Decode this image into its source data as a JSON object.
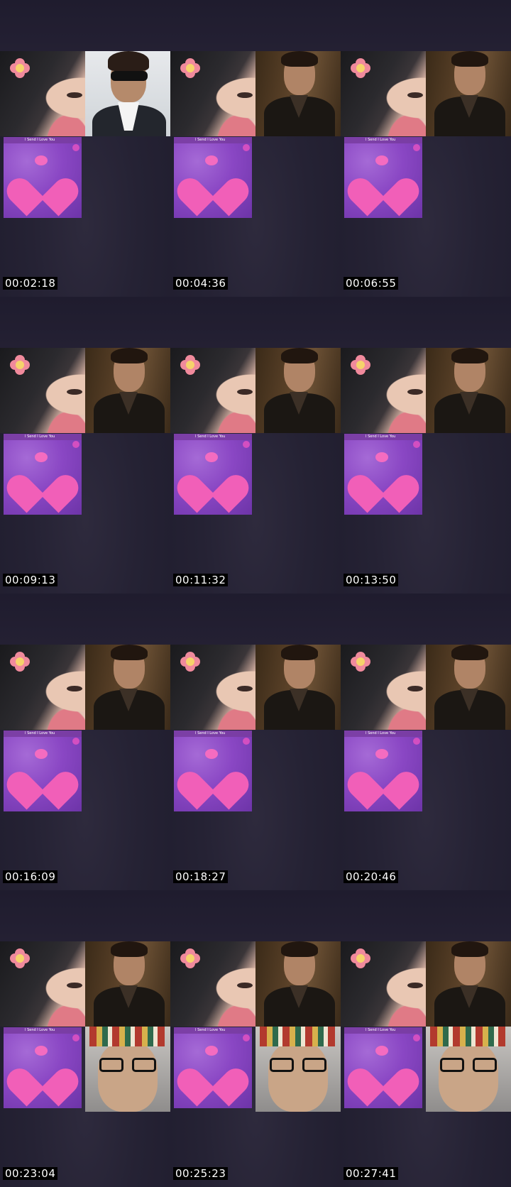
{
  "frames": [
    {
      "timestamp": "00:02:18",
      "top_right": "man-sunglasses",
      "bottom_right": "empty"
    },
    {
      "timestamp": "00:04:36",
      "top_right": "man",
      "bottom_right": "empty"
    },
    {
      "timestamp": "00:06:55",
      "top_right": "man",
      "bottom_right": "empty"
    },
    {
      "timestamp": "00:09:13",
      "top_right": "man",
      "bottom_right": "empty"
    },
    {
      "timestamp": "00:11:32",
      "top_right": "man",
      "bottom_right": "empty"
    },
    {
      "timestamp": "00:13:50",
      "top_right": "man",
      "bottom_right": "empty"
    },
    {
      "timestamp": "00:16:09",
      "top_right": "man",
      "bottom_right": "empty"
    },
    {
      "timestamp": "00:18:27",
      "top_right": "man",
      "bottom_right": "empty"
    },
    {
      "timestamp": "00:20:46",
      "top_right": "man",
      "bottom_right": "empty"
    },
    {
      "timestamp": "00:23:04",
      "top_right": "man",
      "bottom_right": "old-man"
    },
    {
      "timestamp": "00:25:23",
      "top_right": "man",
      "bottom_right": "old-man"
    },
    {
      "timestamp": "00:27:41",
      "top_right": "man",
      "bottom_right": "old-man"
    }
  ],
  "heart_caption": "I Send I Love You",
  "colors": {
    "background": "#1e1b2c",
    "heart": "#f15fb8",
    "timestamp_bg": "#000000"
  }
}
